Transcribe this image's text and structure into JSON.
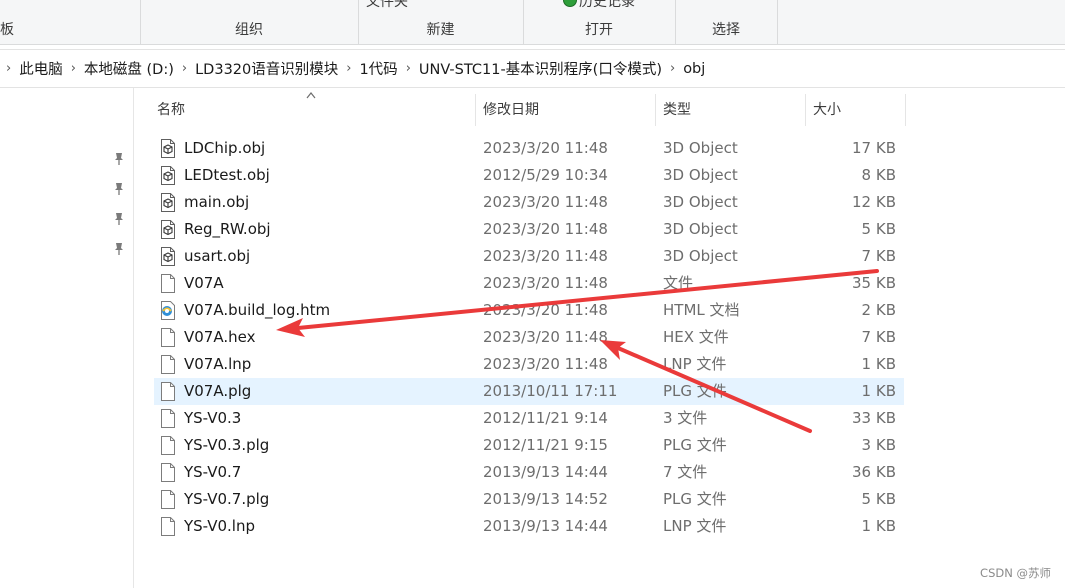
{
  "ribbon": {
    "partial_left_label": "板",
    "groups": [
      {
        "label": "组织"
      },
      {
        "label": "新建",
        "top_label": "文件夹"
      },
      {
        "label": "打开",
        "top_label": "历史记录"
      },
      {
        "label": "选择"
      }
    ]
  },
  "breadcrumb": [
    "此电脑",
    "本地磁盘 (D:)",
    "LD3320语音识别模块",
    "1代码",
    "UNV-STC11-基本识别程序(口令模式)",
    "obj"
  ],
  "columns": {
    "name": "名称",
    "date": "修改日期",
    "type": "类型",
    "size": "大小"
  },
  "files": [
    {
      "name": "LDChip.obj",
      "date": "2023/3/20 11:48",
      "type": "3D Object",
      "size": "17 KB",
      "icon": "3d-object-icon"
    },
    {
      "name": "LEDtest.obj",
      "date": "2012/5/29 10:34",
      "type": "3D Object",
      "size": "8 KB",
      "icon": "3d-object-icon"
    },
    {
      "name": "main.obj",
      "date": "2023/3/20 11:48",
      "type": "3D Object",
      "size": "12 KB",
      "icon": "3d-object-icon"
    },
    {
      "name": "Reg_RW.obj",
      "date": "2023/3/20 11:48",
      "type": "3D Object",
      "size": "5 KB",
      "icon": "3d-object-icon"
    },
    {
      "name": "usart.obj",
      "date": "2023/3/20 11:48",
      "type": "3D Object",
      "size": "7 KB",
      "icon": "3d-object-icon"
    },
    {
      "name": "V07A",
      "date": "2023/3/20 11:48",
      "type": "文件",
      "size": "35 KB",
      "icon": "file-icon"
    },
    {
      "name": "V07A.build_log.htm",
      "date": "2023/3/20 11:48",
      "type": "HTML 文档",
      "size": "2 KB",
      "icon": "html-document-icon"
    },
    {
      "name": "V07A.hex",
      "date": "2023/3/20 11:48",
      "type": "HEX 文件",
      "size": "7 KB",
      "icon": "file-icon"
    },
    {
      "name": "V07A.lnp",
      "date": "2023/3/20 11:48",
      "type": "LNP 文件",
      "size": "1 KB",
      "icon": "file-icon"
    },
    {
      "name": "V07A.plg",
      "date": "2013/10/11 17:11",
      "type": "PLG 文件",
      "size": "1 KB",
      "icon": "file-icon",
      "selected": true
    },
    {
      "name": "YS-V0.3",
      "date": "2012/11/21 9:14",
      "type": "3 文件",
      "size": "33 KB",
      "icon": "file-icon"
    },
    {
      "name": "YS-V0.3.plg",
      "date": "2012/11/21 9:15",
      "type": "PLG 文件",
      "size": "3 KB",
      "icon": "file-icon"
    },
    {
      "name": "YS-V0.7",
      "date": "2013/9/13 14:44",
      "type": "7 文件",
      "size": "36 KB",
      "icon": "file-icon"
    },
    {
      "name": "YS-V0.7.plg",
      "date": "2013/9/13 14:52",
      "type": "PLG 文件",
      "size": "5 KB",
      "icon": "file-icon"
    },
    {
      "name": "YS-V0.lnp",
      "date": "2013/9/13 14:44",
      "type": "LNP 文件",
      "size": "1 KB",
      "icon": "file-icon"
    }
  ],
  "annotation_color": "#ea3a3a",
  "selection_color": "#e5f3ff",
  "watermark": "CSDN @苏师"
}
